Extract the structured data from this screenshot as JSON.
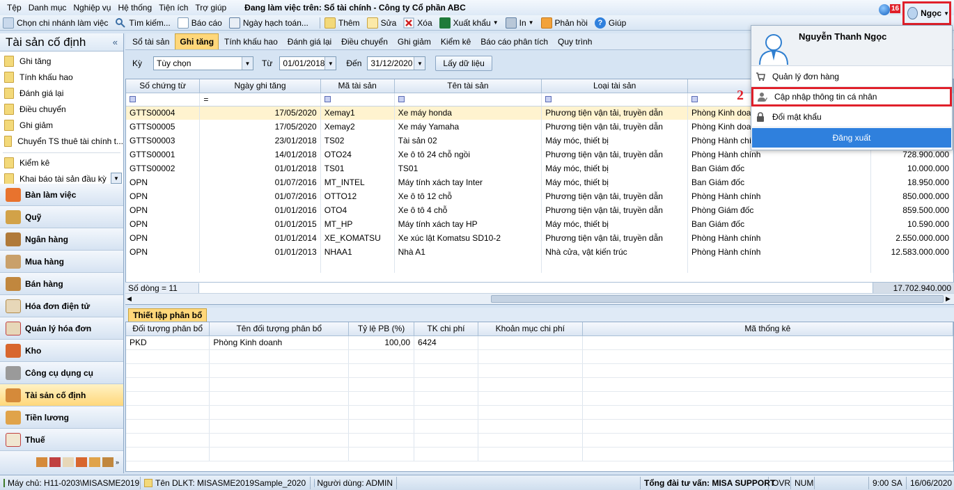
{
  "menu": {
    "items": [
      "Tệp",
      "Danh mục",
      "Nghiệp vụ",
      "Hệ thống",
      "Tiện ích",
      "Trợ giúp"
    ],
    "working_on": "Đang làm việc trên: Sổ tài chính - Công ty Cổ phần ABC"
  },
  "toolbar": {
    "branch": "Chọn chi nhánh làm việc",
    "search": "Tìm kiếm...",
    "report": "Báo cáo",
    "post_date": "Ngày hạch toán...",
    "add": "Thêm",
    "edit": "Sửa",
    "delete": "Xóa",
    "export": "Xuất khẩu",
    "print": "In",
    "feedback": "Phản hồi",
    "help": "Giúp"
  },
  "user": {
    "short_name": "Ngọc",
    "notif_count": "16",
    "full_name": "Nguyễn Thanh Ngọc"
  },
  "user_menu": {
    "orders": "Quản lý đơn hàng",
    "update_profile": "Cập nhập thông tin cá nhân",
    "change_password": "Đổi mật khẩu",
    "logout": "Đăng xuất"
  },
  "annotations": {
    "one": "1",
    "two": "2"
  },
  "left": {
    "title": "Tài sản cố định",
    "sub_items": [
      "Ghi tăng",
      "Tính khấu hao",
      "Đánh giá lại",
      "Điều chuyển",
      "Ghi giảm",
      "Chuyển TS thuê tài chính t...",
      "Kiểm kê",
      "Khai báo tài sản đầu kỳ"
    ],
    "modules": [
      "Bàn làm việc",
      "Quỹ",
      "Ngân hàng",
      "Mua hàng",
      "Bán hàng",
      "Hóa đơn điện tử",
      "Quản lý hóa đơn",
      "Kho",
      "Công cụ dụng cụ",
      "Tài sản cố định",
      "Tiền lương",
      "Thuế"
    ]
  },
  "tabs": [
    "Sổ tài sản",
    "Ghi tăng",
    "Tính khấu hao",
    "Đánh giá lại",
    "Điều chuyển",
    "Ghi giảm",
    "Kiểm kê",
    "Báo cáo phân tích",
    "Quy trình"
  ],
  "filter": {
    "period_label": "Kỳ",
    "period": "Tùy chọn",
    "from_label": "Từ",
    "from": "01/01/2018",
    "to_label": "Đến",
    "to": "31/12/2020",
    "fetch": "Lấy dữ liệu"
  },
  "grid": {
    "headers": [
      "Số chứng từ",
      "Ngày ghi tăng",
      "Mã tài sản",
      "Tên tài sản",
      "Loại tài sản",
      "",
      ""
    ],
    "rows": [
      [
        "GTTS00004",
        "17/05/2020",
        "Xemay1",
        "Xe máy honda",
        "Phương tiện vận tải, truyền dẫn",
        "Phòng Kinh doanh",
        ""
      ],
      [
        "GTTS00005",
        "17/05/2020",
        "Xemay2",
        "Xe máy Yamaha",
        "Phương tiện vận tải, truyền dẫn",
        "Phòng Kinh doanh",
        ""
      ],
      [
        "GTTS00003",
        "23/01/2018",
        "TS02",
        "Tài sản 02",
        "Máy móc, thiết bị",
        "Phòng Hành chính",
        ""
      ],
      [
        "GTTS00001",
        "14/01/2018",
        "OTO24",
        "Xe ô tô 24 chỗ ngồi",
        "Phương tiện vận tải, truyền dẫn",
        "Phòng Hành chính",
        "728.900.000"
      ],
      [
        "GTTS00002",
        "01/01/2018",
        "TS01",
        "TS01",
        "Máy móc, thiết bị",
        "Ban Giám đốc",
        "10.000.000"
      ],
      [
        "OPN",
        "01/07/2016",
        "MT_INTEL",
        "Máy tính xách tay Inter",
        "Máy móc, thiết bị",
        "Ban Giám đốc",
        "18.950.000"
      ],
      [
        "OPN",
        "01/07/2016",
        "OTTO12",
        "Xe ô tô 12 chỗ",
        "Phương tiện vận tải, truyền dẫn",
        "Phòng Hành chính",
        "850.000.000"
      ],
      [
        "OPN",
        "01/01/2016",
        "OTO4",
        "Xe ô tô 4 chỗ",
        "Phương tiện vận tải, truyền dẫn",
        "Phòng Giám đốc",
        "859.500.000"
      ],
      [
        "OPN",
        "01/01/2015",
        "MT_HP",
        "Máy tính xách tay HP",
        "Máy móc, thiết bị",
        "Ban Giám đốc",
        "10.590.000"
      ],
      [
        "OPN",
        "01/01/2014",
        "XE_KOMATSU",
        "Xe xúc lật Komatsu SD10-2",
        "Phương tiện vận tải, truyền dẫn",
        "Phòng Hành chính",
        "2.550.000.000"
      ],
      [
        "OPN",
        "01/01/2013",
        "NHAA1",
        "Nhà A1",
        "Nhà cửa, vật kiến trúc",
        "Phòng Hành chính",
        "12.583.000.000"
      ]
    ],
    "row_count": "Số dòng = 11",
    "total": "17.702.940.000"
  },
  "lower": {
    "tab": "Thiết lập phân bổ",
    "headers": [
      "Đối tượng phân bổ",
      "Tên đối tượng phân bổ",
      "Tỷ lệ PB (%)",
      "TK chi phí",
      "Khoản mục chi phí",
      "Mã thống kê"
    ],
    "rows": [
      [
        "PKD",
        "Phòng Kinh doanh",
        "100,00",
        "6424",
        "",
        ""
      ]
    ]
  },
  "status": {
    "server": "Máy chủ: H11-0203\\MISASME2019",
    "db": "Tên DLKT: MISASME2019Sample_2020",
    "user": "Người dùng: ADMIN",
    "hotline": "Tổng đài tư vấn: MISA SUPPORT",
    "ovr": "OVR",
    "num": "NUM",
    "time": "9:00 SA",
    "date": "16/06/2020"
  }
}
